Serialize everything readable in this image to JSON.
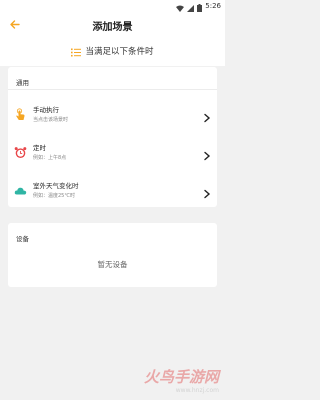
{
  "status_bar": {
    "time": "5:26"
  },
  "app_bar": {
    "title": "添加场景"
  },
  "condition": {
    "label": "当满足以下条件时"
  },
  "general": {
    "header": "通用",
    "items": [
      {
        "title": "手动执行",
        "subtitle": "当点击该场景时",
        "icon": "hand-tap-icon"
      },
      {
        "title": "定时",
        "subtitle": "例如：上午8点",
        "icon": "alarm-clock-icon"
      },
      {
        "title": "室外天气变化时",
        "subtitle": "例如：温度25℃时",
        "icon": "weather-cloud-icon"
      }
    ]
  },
  "devices": {
    "header": "设备",
    "empty": "暂无设备"
  },
  "watermark": {
    "brand": "火鸟手游网",
    "url": "www.hnzj.com"
  },
  "colors": {
    "accent": "#f5a623",
    "alarm": "#e8474a",
    "cloud": "#2fb5a4",
    "background": "#f1f1f1"
  }
}
